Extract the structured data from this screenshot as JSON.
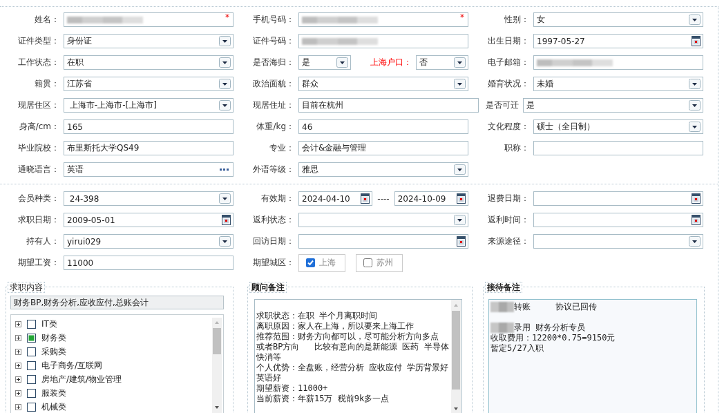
{
  "sections": [
    {
      "rows": [
        {
          "cells": [
            {
              "label": "姓名：",
              "controls": [
                {
                  "kind": "redacted",
                  "required_mark": "*"
                }
              ]
            },
            {
              "label": "手机号码：",
              "controls": [
                {
                  "kind": "redacted",
                  "required_mark": "*"
                }
              ]
            },
            {
              "label": "性别：",
              "controls": [
                {
                  "kind": "select",
                  "value": "女"
                }
              ]
            }
          ]
        },
        {
          "cells": [
            {
              "label": "证件类型：",
              "controls": [
                {
                  "kind": "select",
                  "value": "身份证"
                }
              ]
            },
            {
              "label": "证件号码：",
              "controls": [
                {
                  "kind": "redacted"
                }
              ]
            },
            {
              "label": "出生日期：",
              "controls": [
                {
                  "kind": "date",
                  "value": "1997-05-27"
                }
              ]
            }
          ]
        },
        {
          "cells": [
            {
              "label": "工作状态：",
              "controls": [
                {
                  "kind": "select",
                  "value": "在职"
                }
              ]
            },
            {
              "label": "是否海归：",
              "controls": [
                {
                  "kind": "select",
                  "value": "是"
                },
                {
                  "kind": "label",
                  "text": "上海户口：",
                  "highlighted": true
                },
                {
                  "kind": "select",
                  "value": "否"
                }
              ]
            },
            {
              "label": "电子邮箱：",
              "controls": [
                {
                  "kind": "redacted"
                }
              ]
            }
          ]
        },
        {
          "cells": [
            {
              "label": "籍贯：",
              "controls": [
                {
                  "kind": "select",
                  "value": "江苏省"
                }
              ]
            },
            {
              "label": "政治面貌：",
              "controls": [
                {
                  "kind": "select",
                  "value": "群众"
                }
              ]
            },
            {
              "label": "婚育状况：",
              "controls": [
                {
                  "kind": "select",
                  "value": "未婚"
                }
              ]
            }
          ]
        },
        {
          "cells": [
            {
              "label": "现居住区：",
              "controls": [
                {
                  "kind": "select",
                  "value": " 上海市-上海市-[上海市]"
                }
              ]
            },
            {
              "label": "现居住址：",
              "wide": true,
              "controls": [
                {
                  "kind": "text",
                  "value": "目前在杭州"
                },
                {
                  "kind": "label",
                  "text": "是否可迁",
                  "highlighted": false
                },
                {
                  "kind": "select",
                  "value": "是"
                }
              ]
            }
          ]
        },
        {
          "cells": [
            {
              "label": "身高/cm：",
              "controls": [
                {
                  "kind": "text",
                  "value": "165"
                }
              ]
            },
            {
              "label": "体重/kg：",
              "controls": [
                {
                  "kind": "text",
                  "value": "46"
                }
              ]
            },
            {
              "label": "文化程度：",
              "controls": [
                {
                  "kind": "select",
                  "value": "硕士（全日制）"
                }
              ]
            }
          ]
        },
        {
          "cells": [
            {
              "label": "毕业院校：",
              "controls": [
                {
                  "kind": "text",
                  "value": "布里斯托大学QS49"
                }
              ]
            },
            {
              "label": "专业：",
              "controls": [
                {
                  "kind": "text",
                  "value": "会计&金融与管理"
                }
              ]
            },
            {
              "label": "职称：",
              "controls": [
                {
                  "kind": "text"
                }
              ]
            }
          ]
        },
        {
          "cells": [
            {
              "label": "通晓语言：",
              "controls": [
                {
                  "kind": "lookup",
                  "value": "英语"
                }
              ]
            },
            {
              "label": "外语等级：",
              "controls": [
                {
                  "kind": "select",
                  "value": "雅思"
                }
              ]
            }
          ]
        }
      ]
    },
    {
      "rows": [
        {
          "cells": [
            {
              "label": "会员种类：",
              "controls": [
                {
                  "kind": "select",
                  "value": " 24-398"
                }
              ]
            },
            {
              "label": "有效期：",
              "controls": [
                {
                  "kind": "date",
                  "value": "2024-04-10"
                },
                {
                  "kind": "dash",
                  "text": "----"
                },
                {
                  "kind": "date",
                  "value": "2024-10-09"
                }
              ]
            },
            {
              "label": "退费日期：",
              "controls": [
                {
                  "kind": "date"
                }
              ]
            }
          ]
        },
        {
          "cells": [
            {
              "label": "求职日期：",
              "controls": [
                {
                  "kind": "date",
                  "value": "2009-05-01"
                }
              ]
            },
            {
              "label": "返利状态：",
              "controls": [
                {
                  "kind": "select"
                }
              ]
            },
            {
              "label": "返利时间：",
              "controls": [
                {
                  "kind": "date"
                }
              ]
            }
          ]
        },
        {
          "cells": [
            {
              "label": "持有人：",
              "controls": [
                {
                  "kind": "select",
                  "value": "yirui029"
                }
              ]
            },
            {
              "label": "回访日期：",
              "controls": [
                {
                  "kind": "date"
                }
              ]
            },
            {
              "label": "来源途径：",
              "controls": [
                {
                  "kind": "select"
                }
              ]
            }
          ]
        },
        {
          "cells": [
            {
              "label": "期望工资：",
              "controls": [
                {
                  "kind": "text",
                  "value": "11000"
                }
              ]
            },
            {
              "label": "期望城区：",
              "controls": [
                {
                  "kind": "checkbutton",
                  "text": "上海",
                  "checked": true
                },
                {
                  "kind": "checkbutton",
                  "text": "苏州",
                  "checked": false
                }
              ]
            }
          ]
        }
      ]
    }
  ],
  "job_content": {
    "title": "求职内容",
    "selection": "财务BP,财务分析,应收应付,总账会计",
    "categories": [
      {
        "label": "IT类",
        "checked": false
      },
      {
        "label": "财务类",
        "checked": true
      },
      {
        "label": "采购类",
        "checked": false
      },
      {
        "label": "电子商务/互联网",
        "checked": false
      },
      {
        "label": "房地产/建筑/物业管理",
        "checked": false
      },
      {
        "label": "服装类",
        "checked": false
      },
      {
        "label": "机械类",
        "checked": false
      }
    ]
  },
  "advisor_note": {
    "title": "顾问备注",
    "lines": [
      {
        "text": "求职状态：在职 半个月离职时间"
      },
      {
        "text": "离职原因：家人在上海，所以要来上海工作"
      },
      {
        "text": "推荐范围：财务方向都可以，尽可能分析方向多点"
      },
      {
        "text": "或者BP方向   比较有意向的是新能源 医药 半导体"
      },
      {
        "text": "快消等"
      },
      {
        "text": "个人优势：全盘账，经营分析 应收应付 学历背景好"
      },
      {
        "text": "英语好"
      },
      {
        "text": "期望薪资：11000+"
      },
      {
        "text": "当前薪资：年薪15万 税前9k多一点"
      }
    ]
  },
  "reception_note": {
    "title": "接待备注",
    "paragraphs": [
      {
        "lines": [
          {
            "text": "转账     协议已回传",
            "redacted_prefix": true
          }
        ]
      },
      {
        "lines": [
          {
            "text": "录用 财务分析专员",
            "redacted_prefix": true
          },
          {
            "text": "收取费用：12200*0.75=9150元",
            "redacted_prefix": false
          },
          {
            "text": "暂定5/27入职",
            "redacted_prefix": false
          }
        ]
      }
    ]
  }
}
